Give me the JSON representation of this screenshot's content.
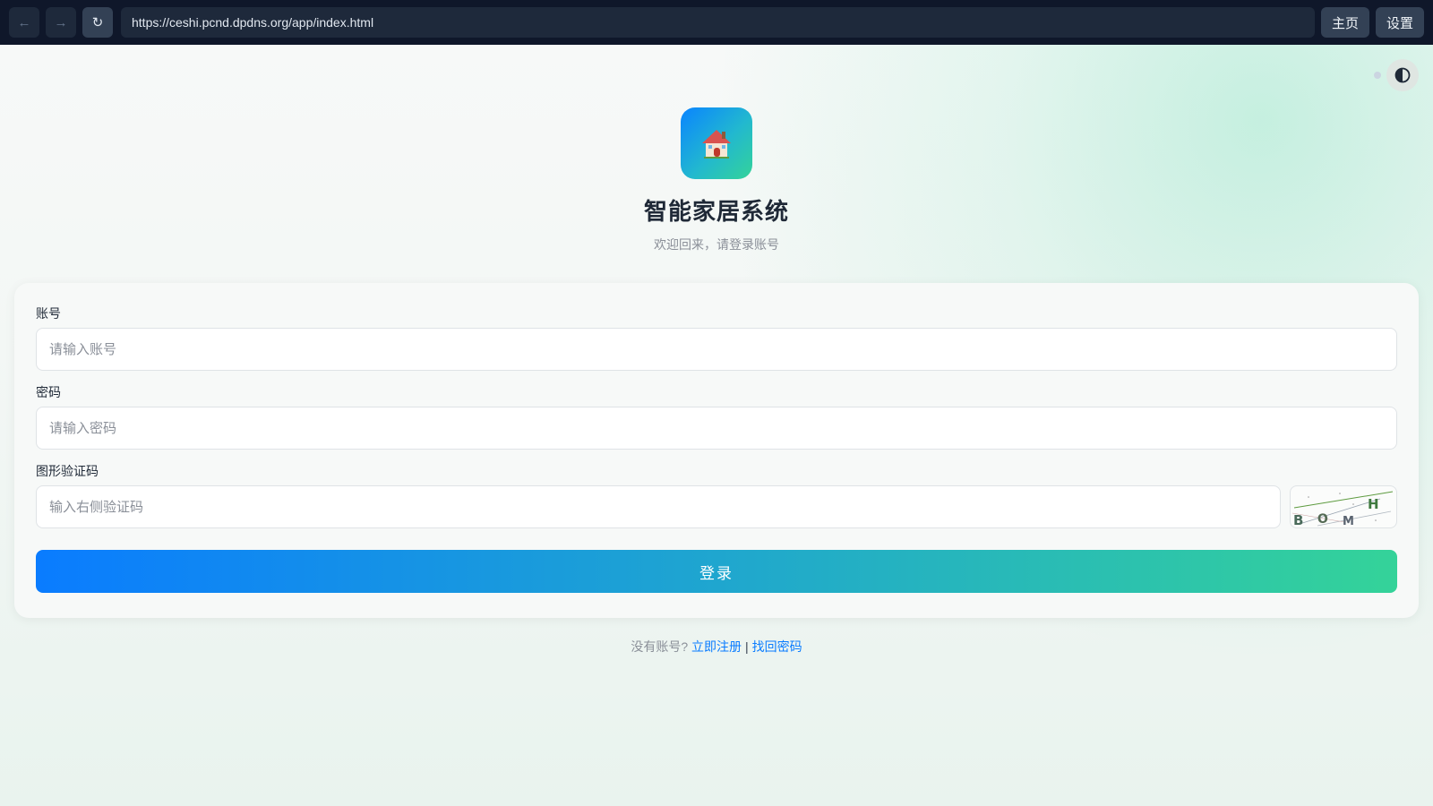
{
  "browser": {
    "back": "←",
    "forward": "→",
    "reload": "↻",
    "url": "https://ceshi.pcnd.dpdns.org/app/index.html",
    "home_label": "主页",
    "settings_label": "设置"
  },
  "header": {
    "logo_icon": "house-icon",
    "title": "智能家居系统",
    "subtitle": "欢迎回来，请登录账号"
  },
  "form": {
    "account": {
      "label": "账号",
      "placeholder": "请输入账号",
      "value": ""
    },
    "password": {
      "label": "密码",
      "placeholder": "请输入密码",
      "value": ""
    },
    "captcha": {
      "label": "图形验证码",
      "placeholder": "输入右侧验证码",
      "value": "",
      "code": "BOMH"
    },
    "login_label": "登录"
  },
  "footer": {
    "prompt": "没有账号?",
    "register": "立即注册",
    "separator": "|",
    "recover": "找回密码"
  },
  "colors": {
    "brand_blue": "#0a7cff",
    "brand_green": "#34d399",
    "chrome_bg": "#0f172a"
  }
}
